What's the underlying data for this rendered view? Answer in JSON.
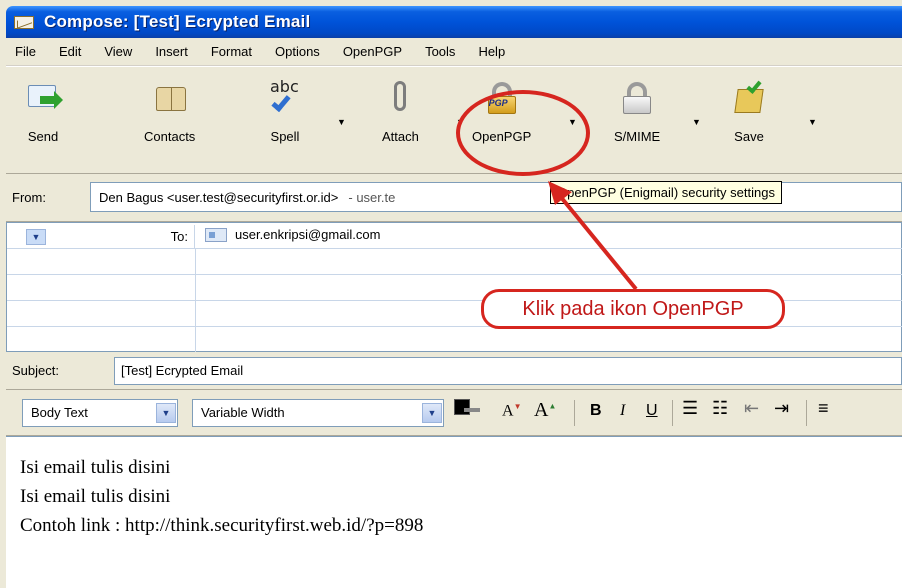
{
  "window": {
    "title": "Compose: [Test] Ecrypted Email"
  },
  "menu": [
    "File",
    "Edit",
    "View",
    "Insert",
    "Format",
    "Options",
    "OpenPGP",
    "Tools",
    "Help"
  ],
  "toolbar": {
    "send": "Send",
    "contacts": "Contacts",
    "spell": "Spell",
    "spell_icon_text": "abc",
    "attach": "Attach",
    "openpgp": "OpenPGP",
    "openpgp_icon_text": "PGP",
    "smime": "S/MIME",
    "save": "Save"
  },
  "header": {
    "from_label": "From:",
    "from_value": "Den Bagus <user.test@securityfirst.or.id>",
    "from_extra": "- user.te",
    "to_label": "To:",
    "to_value": "user.enkripsi@gmail.com",
    "subject_label": "Subject:",
    "subject_value": "[Test] Ecrypted Email"
  },
  "format": {
    "paragraph": "Body Text",
    "font": "Variable Width"
  },
  "body": {
    "line1": "Isi email tulis disini",
    "line2": "Isi email tulis disini",
    "line3": "Contoh link : http://think.securityfirst.web.id/?p=898"
  },
  "tooltip": "OpenPGP (Enigmail) security settings",
  "annotation": {
    "text": "Klik pada ikon OpenPGP",
    "color": "#d6261f"
  },
  "colors": {
    "titlebar": "#0053d9",
    "chrome": "#ece9d8"
  }
}
